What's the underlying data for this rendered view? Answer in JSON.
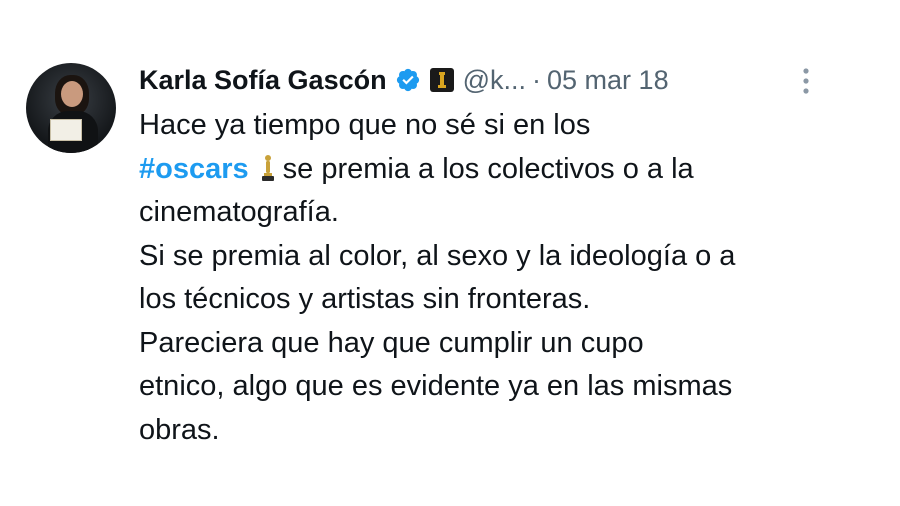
{
  "author": {
    "name": "Karla Sofía Gascón",
    "handle": "@k...",
    "separator": "·",
    "date": "05 mar 18"
  },
  "icons": {
    "verified": "verified-badge-icon",
    "affiliation": "affiliation-badge-icon",
    "more": "more-options-icon",
    "trophy": "oscar-trophy-icon",
    "avatar": "profile-photo"
  },
  "colors": {
    "link": "#1d9bf0",
    "text": "#0f1419",
    "secondary": "#536471"
  },
  "tweet": {
    "line1": "Hace ya tiempo que no sé si en los",
    "hashtag": "#oscars",
    "line2_rest": "se premia a los colectivos o a la",
    "line3": "cinematografía.",
    "line4": "Si se premia al color, al sexo y la ideología o a",
    "line5": "los técnicos y artistas sin fronteras.",
    "line6": "Pareciera que hay que cumplir un cupo",
    "line7": "etnico, algo que es evidente ya en las mismas",
    "line8": "obras."
  }
}
